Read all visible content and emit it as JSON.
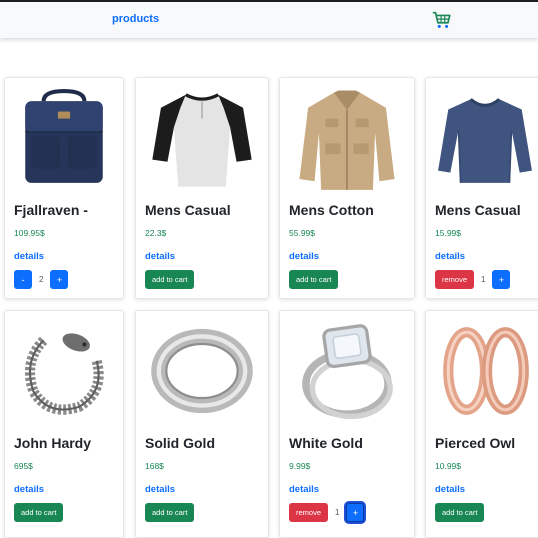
{
  "nav": {
    "link_label": "products",
    "cart_icon": "shopping-cart-icon",
    "cart_color": "#198754"
  },
  "colors": {
    "primary": "#0d6efd",
    "success": "#198754",
    "danger": "#dc3545"
  },
  "products": [
    {
      "title": "Fjallraven -",
      "price": "109.95$",
      "details": "details",
      "image": "backpack-image",
      "state": "stepper",
      "minus": "-",
      "qty": "2",
      "plus": "+"
    },
    {
      "title": "Mens Casual",
      "price": "22.3$",
      "details": "details",
      "image": "raglan-tshirt-image",
      "state": "add",
      "add_label": "add to cart"
    },
    {
      "title": "Mens Cotton",
      "price": "55.99$",
      "details": "details",
      "image": "cotton-jacket-image",
      "state": "add",
      "add_label": "add to cart"
    },
    {
      "title": "Mens Casual",
      "price": "15.99$",
      "details": "details",
      "image": "slim-fit-shirt-image",
      "state": "remove",
      "remove_label": "remove",
      "qty": "1",
      "plus": "+"
    },
    {
      "title": "John Hardy",
      "price": "695$",
      "details": "details",
      "image": "chain-bracelet-image",
      "state": "add",
      "add_label": "add to cart"
    },
    {
      "title": "Solid Gold",
      "price": "168$",
      "details": "details",
      "image": "silver-ring-image",
      "state": "add",
      "add_label": "add to cart"
    },
    {
      "title": "White Gold",
      "price": "9.99$",
      "details": "details",
      "image": "diamond-ring-image",
      "state": "remove",
      "remove_label": "remove",
      "qty": "1",
      "plus": "+"
    },
    {
      "title": "Pierced Owl",
      "price": "10.99$",
      "details": "details",
      "image": "rose-gold-rings-image",
      "state": "add",
      "add_label": "add to cart"
    }
  ]
}
